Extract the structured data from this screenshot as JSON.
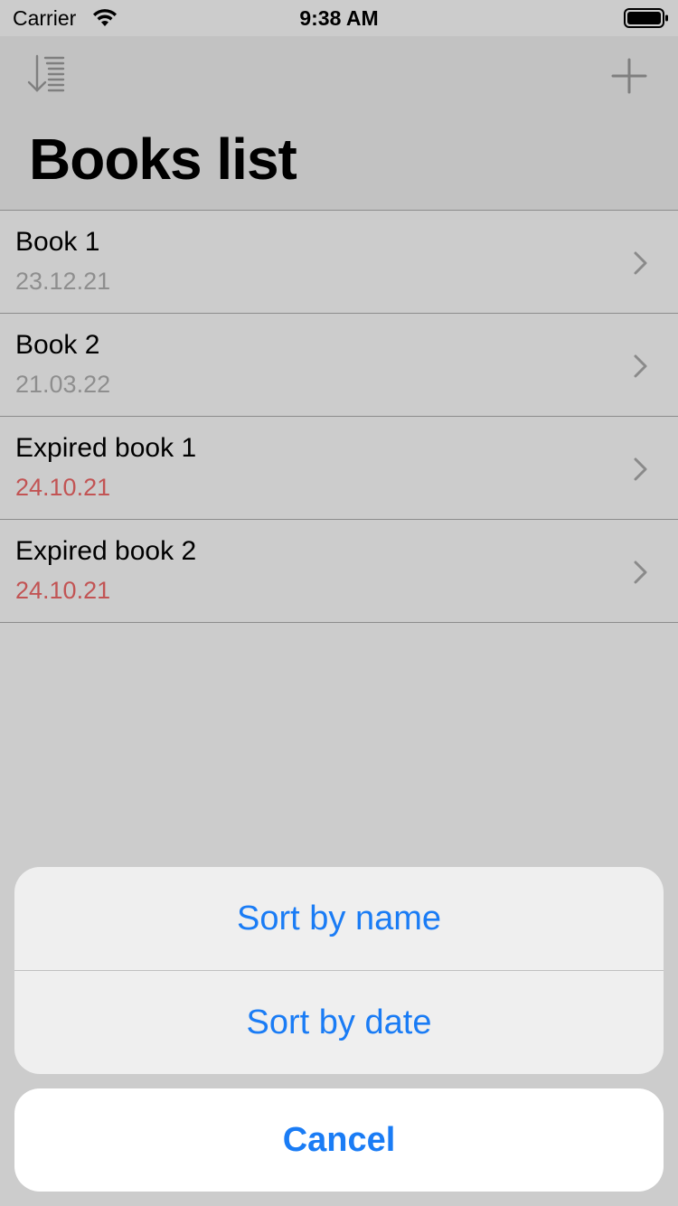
{
  "status_bar": {
    "carrier": "Carrier",
    "time": "9:38 AM"
  },
  "nav": {
    "title": "Books list",
    "left_icon": "sort-icon",
    "right_icon": "plus-icon"
  },
  "books": [
    {
      "title": "Book 1",
      "date": "23.12.21",
      "expired": false
    },
    {
      "title": "Book 2",
      "date": "21.03.22",
      "expired": false
    },
    {
      "title": "Expired book 1",
      "date": "24.10.21",
      "expired": true
    },
    {
      "title": "Expired book 2",
      "date": "24.10.21",
      "expired": true
    }
  ],
  "action_sheet": {
    "options": [
      "Sort by name",
      "Sort by date"
    ],
    "cancel": "Cancel"
  },
  "colors": {
    "accent": "#1a7cf5",
    "expired_date": "#c25454",
    "normal_date": "#8e8e8e"
  }
}
